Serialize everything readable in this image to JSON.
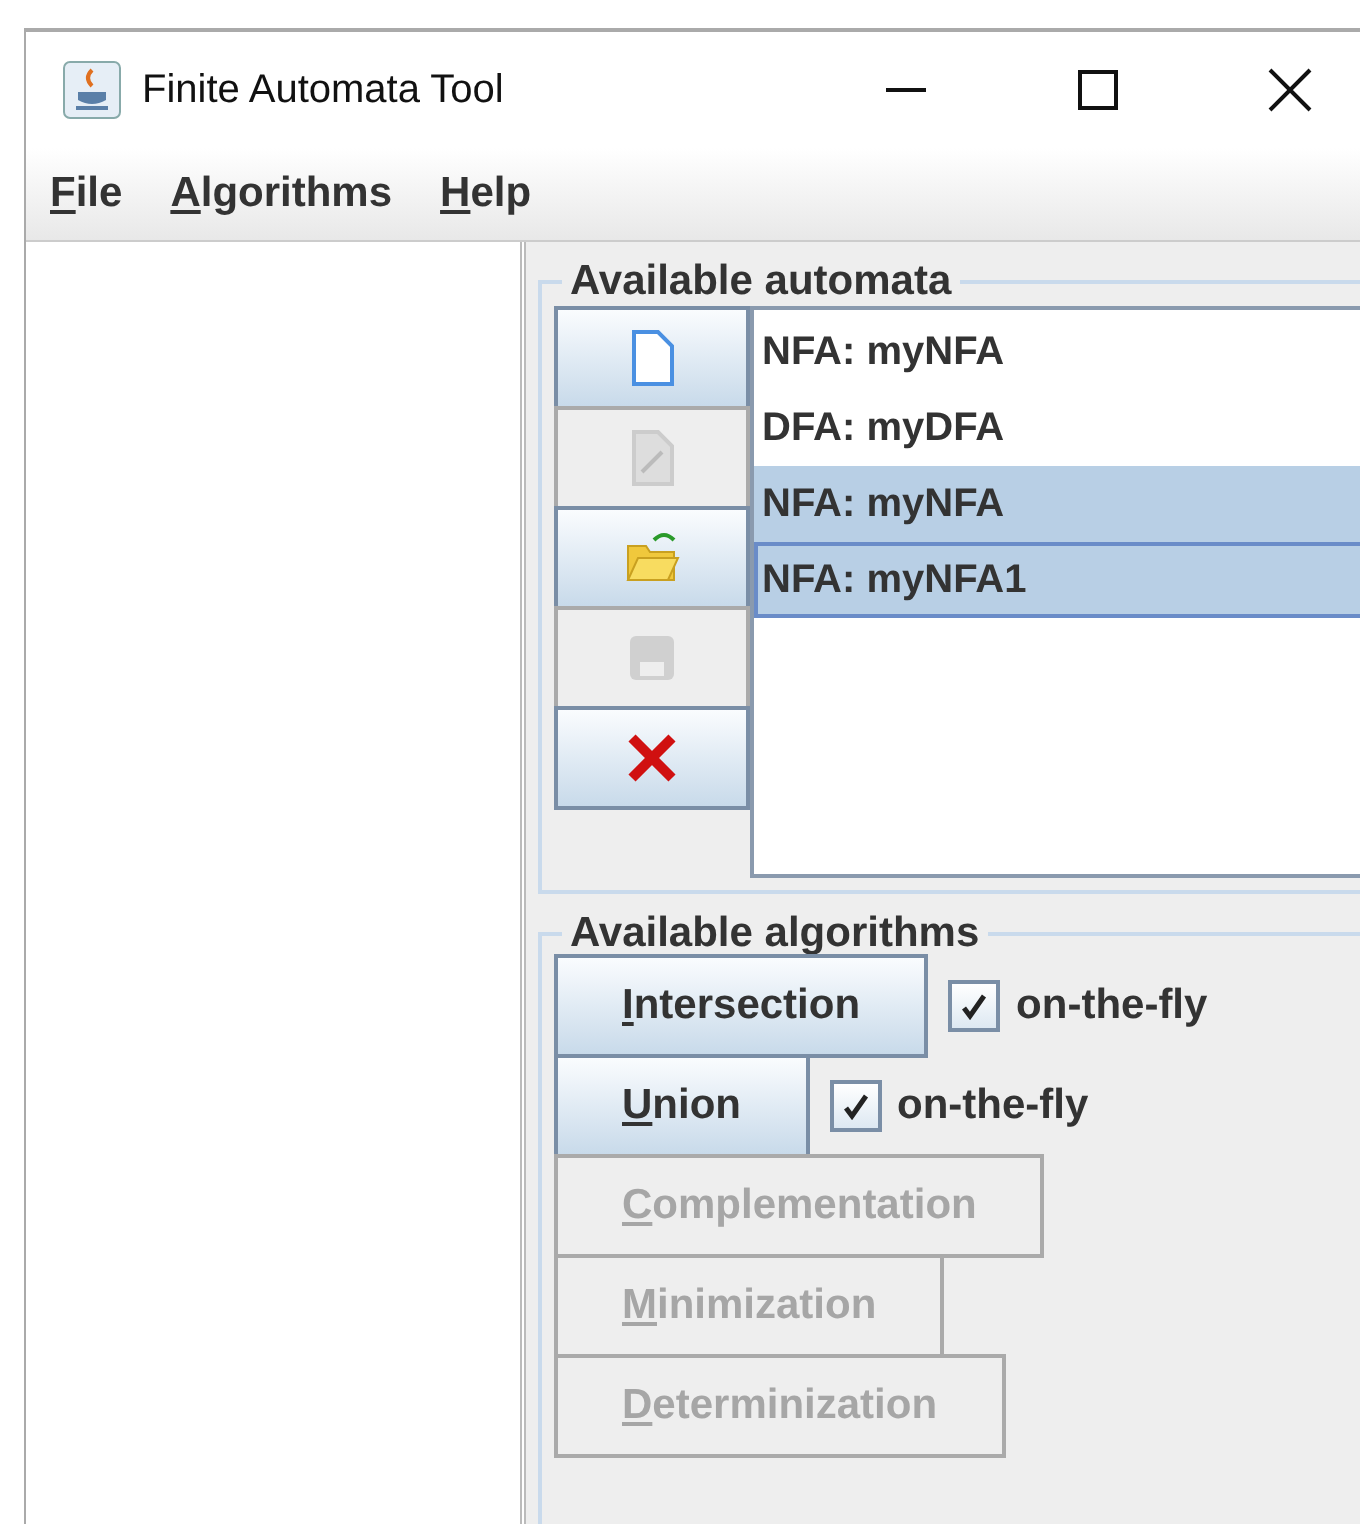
{
  "window": {
    "title": "Finite Automata Tool"
  },
  "menu": [
    {
      "label": "File"
    },
    {
      "label": "Algorithms"
    },
    {
      "label": "Help"
    }
  ],
  "automata_panel": {
    "title": "Available automata",
    "tools": [
      {
        "kind": "new",
        "disabled": false
      },
      {
        "kind": "edit",
        "disabled": true
      },
      {
        "kind": "open",
        "disabled": false
      },
      {
        "kind": "save",
        "disabled": true
      },
      {
        "kind": "delete",
        "disabled": false
      }
    ],
    "items": [
      {
        "label": "NFA: myNFA",
        "selected": false,
        "focused": false
      },
      {
        "label": "DFA: myDFA",
        "selected": false,
        "focused": false
      },
      {
        "label": "NFA: myNFA",
        "selected": true,
        "focused": false
      },
      {
        "label": "NFA: myNFA1",
        "selected": true,
        "focused": true
      }
    ]
  },
  "algorithms_panel": {
    "title": "Available algorithms",
    "algorithms": [
      {
        "label": "Intersection",
        "disabled": false,
        "option": {
          "label": "on-the-fly",
          "checked": true
        }
      },
      {
        "label": "Union",
        "disabled": false,
        "option": {
          "label": "on-the-fly",
          "checked": true
        }
      },
      {
        "label": "Complementation",
        "disabled": true
      },
      {
        "label": "Minimization",
        "disabled": true
      },
      {
        "label": "Determinization",
        "disabled": true
      }
    ]
  }
}
